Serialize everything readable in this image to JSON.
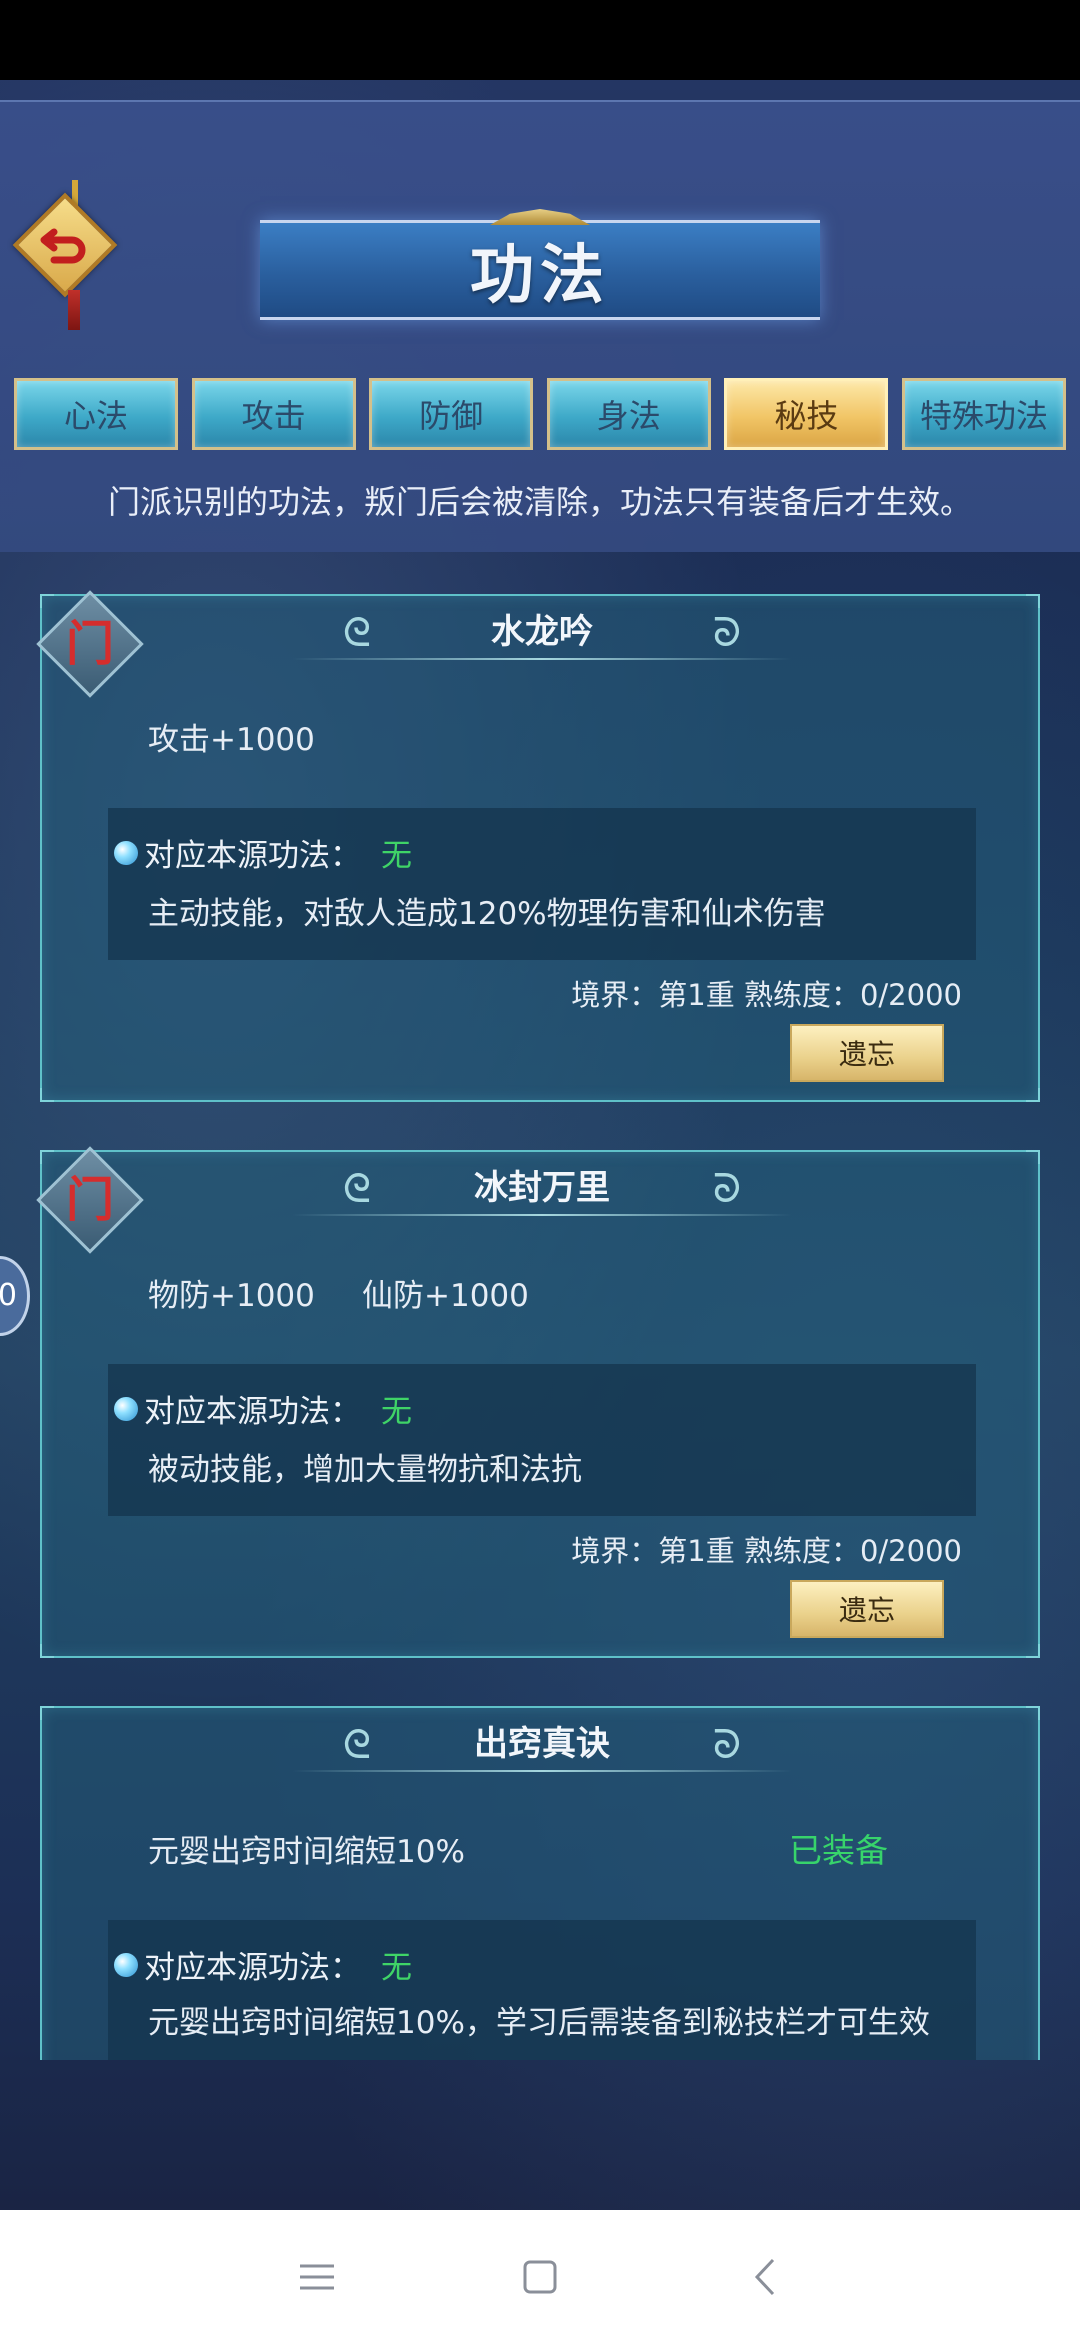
{
  "header": {
    "title": "功法",
    "notice": "门派识别的功法，叛门后会被清除，功法只有装备后才生效。"
  },
  "tabs": [
    {
      "label": "心法",
      "active": false
    },
    {
      "label": "攻击",
      "active": false
    },
    {
      "label": "防御",
      "active": false
    },
    {
      "label": "身法",
      "active": false
    },
    {
      "label": "秘技",
      "active": true
    },
    {
      "label": "特殊功法",
      "active": false
    }
  ],
  "badge_glyph": "门",
  "edge_marker": "0",
  "cards": [
    {
      "name": "水龙吟",
      "stats": [
        "攻击+1000"
      ],
      "source_label": "对应本源功法：",
      "source_value": "无",
      "description": "主动技能，对敌人造成120%物理伤害和仙术伤害",
      "progress": "境界：第1重 熟练度：0/2000",
      "button": "遗忘"
    },
    {
      "name": "冰封万里",
      "stats": [
        "物防+1000",
        "仙防+1000"
      ],
      "source_label": "对应本源功法：",
      "source_value": "无",
      "description": "被动技能，增加大量物抗和法抗",
      "progress": "境界：第1重 熟练度：0/2000",
      "button": "遗忘"
    },
    {
      "name": "出窍真诀",
      "stats": [
        "元婴出窍时间缩短10%"
      ],
      "status": "已装备",
      "source_label": "对应本源功法：",
      "source_value": "无",
      "description": "元婴出窍时间缩短10%，学习后需装备到秘技栏才可生效"
    }
  ],
  "nav": {
    "menu_icon": "menu-icon",
    "home_icon": "home-square-icon",
    "back_icon": "back-chevron-icon"
  },
  "colors": {
    "active_tab": "#f1c566",
    "tab": "#3ea9c8",
    "green_text": "#3fd467",
    "card_border": "#5fc1c9"
  }
}
